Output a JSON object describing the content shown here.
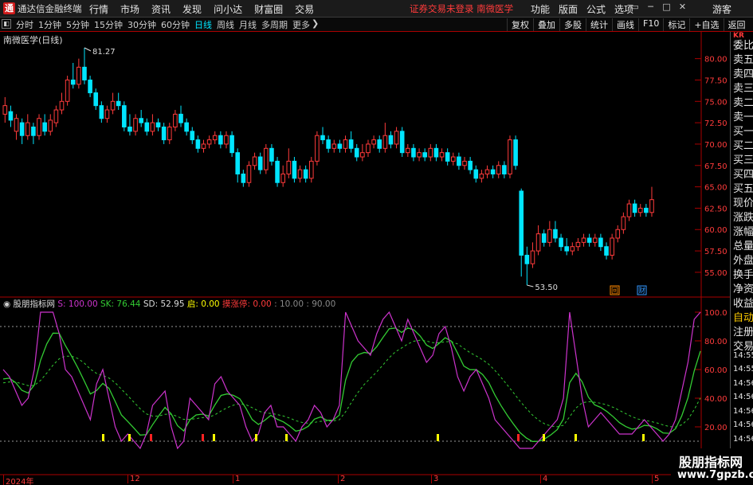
{
  "titlebar": {
    "app_name": "通达信金融终端",
    "menus": [
      "行情",
      "市场",
      "资讯",
      "发现",
      "问小达",
      "财富圈",
      "交易"
    ],
    "center": "证券交易未登录  南微医学",
    "right_menus": [
      "功能",
      "版面",
      "公式",
      "选项"
    ],
    "guest": "游客"
  },
  "toolbar": {
    "periods": [
      "分时",
      "1分钟",
      "5分钟",
      "15分钟",
      "30分钟",
      "60分钟",
      "日线",
      "周线",
      "月线",
      "多周期",
      "更多"
    ],
    "active_period": "日线",
    "right_tools": [
      "复权",
      "叠加",
      "多股",
      "统计",
      "画线",
      "F10",
      "标记",
      "+自选",
      "返回"
    ]
  },
  "chart": {
    "title": "南微医学(日线)",
    "price_ticks": [
      "80.00",
      "77.50",
      "75.00",
      "72.50",
      "70.00",
      "67.50",
      "65.00",
      "62.50",
      "60.00",
      "57.50",
      "55.00"
    ],
    "high_label": "81.27",
    "low_label": "53.50",
    "markers": [
      "回",
      "财"
    ],
    "colors": {
      "up": "#ff3b3b",
      "down": "#00e5ff",
      "background": "#000000"
    }
  },
  "indicator": {
    "name": "股朋指标网",
    "s": "S: 100.00",
    "sk": "SK: 76.44",
    "sd": "SD: 52.95",
    "qi": "启: 0.00",
    "zhang": "摸涨停: 0.00",
    "rest": ": 10.00 : 90.00",
    "ticks": [
      "100.0",
      "80.00",
      "60.00",
      "40.00",
      "20.00"
    ],
    "colors": {
      "s": "#cc33cc",
      "sk": "#33cc33",
      "sd": "#33cc33"
    }
  },
  "xaxis": [
    "2024年",
    "12",
    "1",
    "2",
    "3",
    "4",
    "5"
  ],
  "sidepanel": {
    "items": [
      "委比",
      "卖五",
      "卖四",
      "卖三",
      "卖二",
      "卖一",
      "买一",
      "买二",
      "买三",
      "买四",
      "买五",
      "现价",
      "涨跌",
      "涨幅",
      "总量",
      "外盘",
      "换手",
      "净资",
      "收益",
      "自动",
      "注册",
      "交易",
      "14:55",
      "14:55",
      "14:56",
      "14:56",
      "14:56",
      "14:56",
      "14:56"
    ],
    "top_tag": "KR"
  },
  "watermark": {
    "line1": "股朋指标网",
    "line2": "www.7gpzb.com"
  },
  "chart_data": {
    "type": "candlestick",
    "title": "南微医学(日线)",
    "ylim": [
      53.5,
      81.27
    ],
    "candles": [
      [
        73.5,
        74.5,
        75.5,
        72.5
      ],
      [
        73.8,
        72.8,
        74.5,
        72.0
      ],
      [
        71.5,
        73.0,
        73.5,
        70.5
      ],
      [
        72.5,
        71.0,
        73.0,
        70.0
      ],
      [
        71.0,
        72.5,
        73.5,
        70.5
      ],
      [
        72.0,
        71.0,
        72.5,
        70.0
      ],
      [
        71.0,
        73.0,
        73.5,
        70.5
      ],
      [
        72.5,
        71.5,
        73.5,
        71.0
      ],
      [
        71.5,
        72.8,
        73.5,
        71.0
      ],
      [
        72.5,
        74.0,
        74.5,
        72.0
      ],
      [
        74.0,
        75.0,
        76.0,
        73.5
      ],
      [
        75.0,
        77.5,
        78.0,
        74.5
      ],
      [
        77.5,
        77.0,
        79.5,
        76.5
      ],
      [
        77.0,
        79.0,
        80.0,
        76.5
      ],
      [
        79.0,
        77.5,
        81.27,
        77.0
      ],
      [
        77.5,
        76.0,
        78.0,
        75.5
      ],
      [
        76.0,
        74.5,
        76.5,
        74.0
      ],
      [
        74.5,
        73.0,
        75.0,
        72.5
      ],
      [
        73.0,
        74.0,
        74.5,
        72.5
      ],
      [
        74.0,
        75.0,
        76.0,
        73.5
      ],
      [
        75.0,
        74.5,
        76.0,
        74.0
      ],
      [
        74.5,
        72.0,
        75.0,
        71.5
      ],
      [
        72.0,
        71.5,
        73.5,
        71.0
      ],
      [
        71.5,
        73.0,
        73.5,
        71.0
      ],
      [
        73.0,
        72.5,
        74.0,
        72.0
      ],
      [
        72.5,
        71.5,
        73.0,
        71.0
      ],
      [
        71.5,
        72.5,
        73.5,
        71.0
      ],
      [
        72.5,
        72.0,
        73.0,
        71.5
      ],
      [
        72.0,
        70.5,
        72.5,
        70.0
      ],
      [
        70.5,
        72.0,
        72.5,
        70.0
      ],
      [
        72.0,
        73.5,
        74.0,
        71.5
      ],
      [
        73.5,
        72.5,
        74.5,
        72.0
      ],
      [
        72.5,
        71.5,
        73.0,
        71.0
      ],
      [
        71.5,
        70.5,
        72.0,
        70.0
      ],
      [
        70.5,
        69.5,
        71.0,
        69.0
      ],
      [
        69.5,
        70.0,
        70.5,
        69.0
      ],
      [
        70.0,
        70.5,
        71.0,
        69.5
      ],
      [
        70.5,
        71.0,
        71.5,
        70.0
      ],
      [
        71.0,
        70.0,
        71.5,
        69.5
      ],
      [
        70.0,
        71.0,
        71.5,
        69.5
      ],
      [
        71.0,
        69.0,
        71.5,
        68.5
      ],
      [
        69.0,
        66.5,
        69.5,
        65.5
      ],
      [
        66.5,
        65.5,
        67.0,
        65.0
      ],
      [
        65.5,
        67.5,
        68.0,
        65.0
      ],
      [
        67.5,
        68.5,
        69.0,
        67.0
      ],
      [
        68.5,
        67.0,
        69.0,
        66.5
      ],
      [
        67.0,
        69.5,
        70.0,
        66.5
      ],
      [
        69.5,
        68.0,
        70.0,
        67.5
      ],
      [
        68.0,
        65.5,
        68.5,
        65.0
      ],
      [
        65.5,
        66.5,
        67.5,
        65.0
      ],
      [
        66.5,
        68.0,
        69.5,
        66.0
      ],
      [
        68.0,
        66.0,
        68.5,
        65.5
      ],
      [
        66.0,
        67.0,
        67.5,
        65.5
      ],
      [
        67.0,
        66.0,
        67.5,
        65.5
      ],
      [
        66.0,
        68.0,
        68.5,
        65.5
      ],
      [
        68.0,
        71.0,
        71.5,
        67.5
      ],
      [
        71.0,
        70.5,
        72.0,
        70.0
      ],
      [
        70.5,
        69.5,
        71.0,
        69.0
      ],
      [
        69.5,
        70.0,
        70.5,
        69.0
      ],
      [
        70.0,
        69.5,
        70.5,
        69.0
      ],
      [
        69.5,
        70.5,
        71.0,
        69.0
      ],
      [
        70.5,
        69.5,
        71.5,
        69.0
      ],
      [
        69.5,
        68.5,
        70.0,
        68.0
      ],
      [
        68.5,
        69.0,
        70.0,
        68.0
      ],
      [
        69.0,
        70.0,
        70.5,
        68.5
      ],
      [
        70.0,
        70.5,
        71.0,
        69.5
      ],
      [
        70.5,
        69.5,
        71.0,
        69.0
      ],
      [
        69.5,
        71.0,
        72.5,
        69.0
      ],
      [
        71.0,
        70.0,
        71.5,
        69.5
      ],
      [
        70.0,
        71.5,
        72.0,
        69.5
      ],
      [
        71.5,
        69.0,
        72.0,
        68.5
      ],
      [
        69.0,
        69.5,
        70.0,
        68.5
      ],
      [
        69.5,
        68.5,
        70.0,
        68.0
      ],
      [
        68.5,
        69.0,
        69.5,
        68.0
      ],
      [
        69.0,
        68.5,
        69.5,
        68.0
      ],
      [
        68.5,
        69.5,
        70.0,
        68.0
      ],
      [
        69.5,
        68.5,
        70.0,
        68.0
      ],
      [
        68.5,
        69.0,
        69.5,
        68.0
      ],
      [
        69.0,
        68.0,
        69.5,
        67.5
      ],
      [
        68.0,
        68.5,
        69.0,
        67.5
      ],
      [
        68.5,
        67.5,
        69.0,
        67.0
      ],
      [
        67.5,
        68.0,
        68.5,
        67.0
      ],
      [
        68.0,
        67.0,
        68.5,
        66.5
      ],
      [
        67.0,
        66.0,
        67.5,
        65.5
      ],
      [
        66.0,
        66.5,
        67.0,
        65.5
      ],
      [
        66.5,
        67.0,
        67.5,
        66.0
      ],
      [
        67.0,
        66.5,
        67.5,
        66.0
      ],
      [
        66.5,
        67.5,
        68.0,
        66.0
      ],
      [
        67.5,
        66.5,
        68.0,
        66.0
      ],
      [
        66.5,
        70.5,
        71.0,
        66.0
      ],
      [
        70.5,
        67.5,
        71.0,
        67.0
      ],
      [
        64.5,
        57.0,
        64.8,
        54.5
      ],
      [
        57.0,
        56.0,
        58.0,
        53.5
      ],
      [
        56.0,
        57.5,
        58.5,
        55.5
      ],
      [
        57.5,
        59.5,
        60.5,
        57.0
      ],
      [
        59.5,
        58.5,
        60.0,
        58.0
      ],
      [
        58.5,
        60.0,
        61.0,
        58.0
      ],
      [
        60.0,
        59.0,
        61.0,
        58.5
      ],
      [
        59.0,
        58.0,
        59.5,
        57.5
      ],
      [
        58.0,
        57.5,
        59.0,
        57.0
      ],
      [
        57.5,
        58.0,
        58.5,
        57.0
      ],
      [
        58.0,
        58.5,
        59.0,
        57.5
      ],
      [
        58.5,
        59.0,
        59.5,
        58.0
      ],
      [
        59.0,
        58.5,
        59.5,
        58.0
      ],
      [
        58.5,
        59.0,
        59.5,
        58.0
      ],
      [
        59.0,
        58.0,
        59.5,
        57.5
      ],
      [
        58.0,
        57.0,
        58.5,
        56.5
      ],
      [
        57.0,
        59.0,
        59.5,
        56.5
      ],
      [
        59.0,
        60.0,
        60.5,
        58.5
      ],
      [
        60.0,
        61.5,
        62.0,
        59.5
      ],
      [
        61.5,
        63.0,
        63.5,
        61.0
      ],
      [
        63.0,
        62.0,
        63.5,
        61.5
      ],
      [
        62.0,
        62.5,
        63.0,
        61.5
      ],
      [
        62.5,
        62.0,
        63.0,
        61.5
      ],
      [
        62.0,
        63.5,
        65.0,
        61.5
      ]
    ]
  }
}
